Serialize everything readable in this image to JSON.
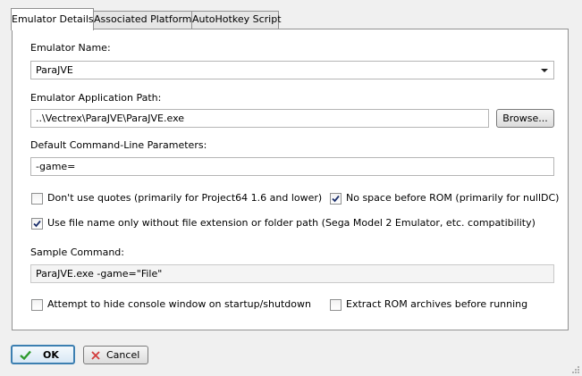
{
  "tabs": [
    {
      "label": "Emulator Details"
    },
    {
      "label": "Associated Platforms"
    },
    {
      "label": "AutoHotkey Script"
    }
  ],
  "emulator_name": {
    "label": "Emulator Name:",
    "value": "ParaJVE"
  },
  "app_path": {
    "label": "Emulator Application Path:",
    "value": "..\\Vectrex\\ParaJVE\\ParaJVE.exe",
    "browse_label": "Browse..."
  },
  "params": {
    "label": "Default Command-Line Parameters:",
    "value": "-game="
  },
  "checkboxes": {
    "no_quotes": {
      "label": "Don't use quotes (primarily for Project64 1.6 and lower)",
      "checked": false
    },
    "no_space": {
      "label": "No space before ROM (primarily for nullDC)",
      "checked": true
    },
    "file_name_only": {
      "label": "Use file name only without file extension or folder path (Sega Model 2 Emulator, etc. compatibility)",
      "checked": true
    },
    "hide_console": {
      "label": "Attempt to hide console window on startup/shutdown",
      "checked": false
    },
    "extract_rom": {
      "label": "Extract ROM archives before running",
      "checked": false
    }
  },
  "sample": {
    "label": "Sample Command:",
    "value": "ParaJVE.exe -game=\"File\""
  },
  "buttons": {
    "ok": "OK",
    "cancel": "Cancel"
  },
  "colors": {
    "ok_check": "#2e9a2e",
    "cancel_x": "#d23b3b",
    "ok_border": "#3c7fb1"
  }
}
